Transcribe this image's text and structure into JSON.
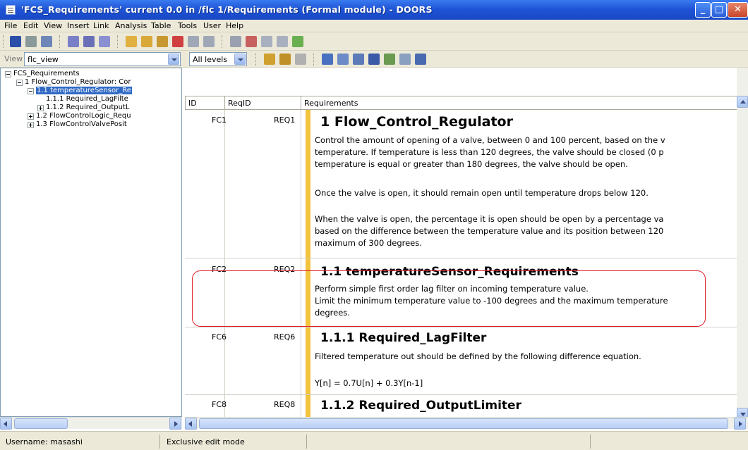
{
  "window": {
    "title": "'FCS_Requirements' current 0.0 in /flc 1/Requirements (Formal module) - DOORS"
  },
  "menu": [
    "File",
    "Edit",
    "View",
    "Insert",
    "Link",
    "Analysis",
    "Table",
    "Tools",
    "User",
    "Help"
  ],
  "view_bar": {
    "view_label": "View",
    "view_value": "flc_view",
    "levels_value": "All levels"
  },
  "tree": {
    "root": "FCS_Requirements",
    "node1": "1 Flow_Control_Regulator: Cor",
    "node1_1": "1.1 temperatureSensor_Re",
    "node1_1_1": "1.1.1 Required_LagFilte",
    "node1_1_2": "1.1.2 Required_OutputL",
    "node1_2": "1.2 FlowControlLogic_Requ",
    "node1_3": "1.3 FlowControlValvePosit"
  },
  "grid": {
    "headers": [
      "ID",
      "ReqID",
      "Requirements"
    ],
    "rows": [
      {
        "id": "FC1",
        "reqid": "REQ1",
        "heading": "1 Flow_Control_Regulator",
        "text": [
          "Control the amount of opening of a valve, between 0 and 100 percent, based on the v",
          "temperature. If temperature is less than 120 degrees, the valve should be closed (0 p",
          "temperature is equal or greater than 180 degrees, the valve should be open.",
          "",
          "Once the valve is open, it should remain open until temperature drops below 120.",
          "",
          "When  the valve is open, the percentage it is open should be open by a percentage va",
          "based on the difference between the temperature value and its position between 120",
          "maximum of 300 degrees."
        ]
      },
      {
        "id": "FC2",
        "reqid": "REQ2",
        "heading": "1.1 temperatureSensor_Requirements",
        "text": [
          "Perform simple first order lag filter on incoming temperature value.",
          "Limit the minimum temperature value to -100 degrees and the maximum temperature",
          "degrees."
        ]
      },
      {
        "id": "FC6",
        "reqid": "REQ6",
        "heading": "1.1.1 Required_LagFilter",
        "text": [
          "Filtered temperature out should be defined by the following difference equation.",
          "",
          "Y[n] = 0.7U[n] + 0.3Y[n-1]"
        ]
      },
      {
        "id": "FC8",
        "reqid": "REQ8",
        "heading": "1.1.2 Required_OutputLimiter",
        "text": []
      }
    ]
  },
  "status": {
    "username": "Username: masashi",
    "mode": "Exclusive edit mode"
  },
  "colors": {
    "titlebar": "#2456d8",
    "highlight": "#e0202a",
    "change_bar": "#f2c33c"
  }
}
